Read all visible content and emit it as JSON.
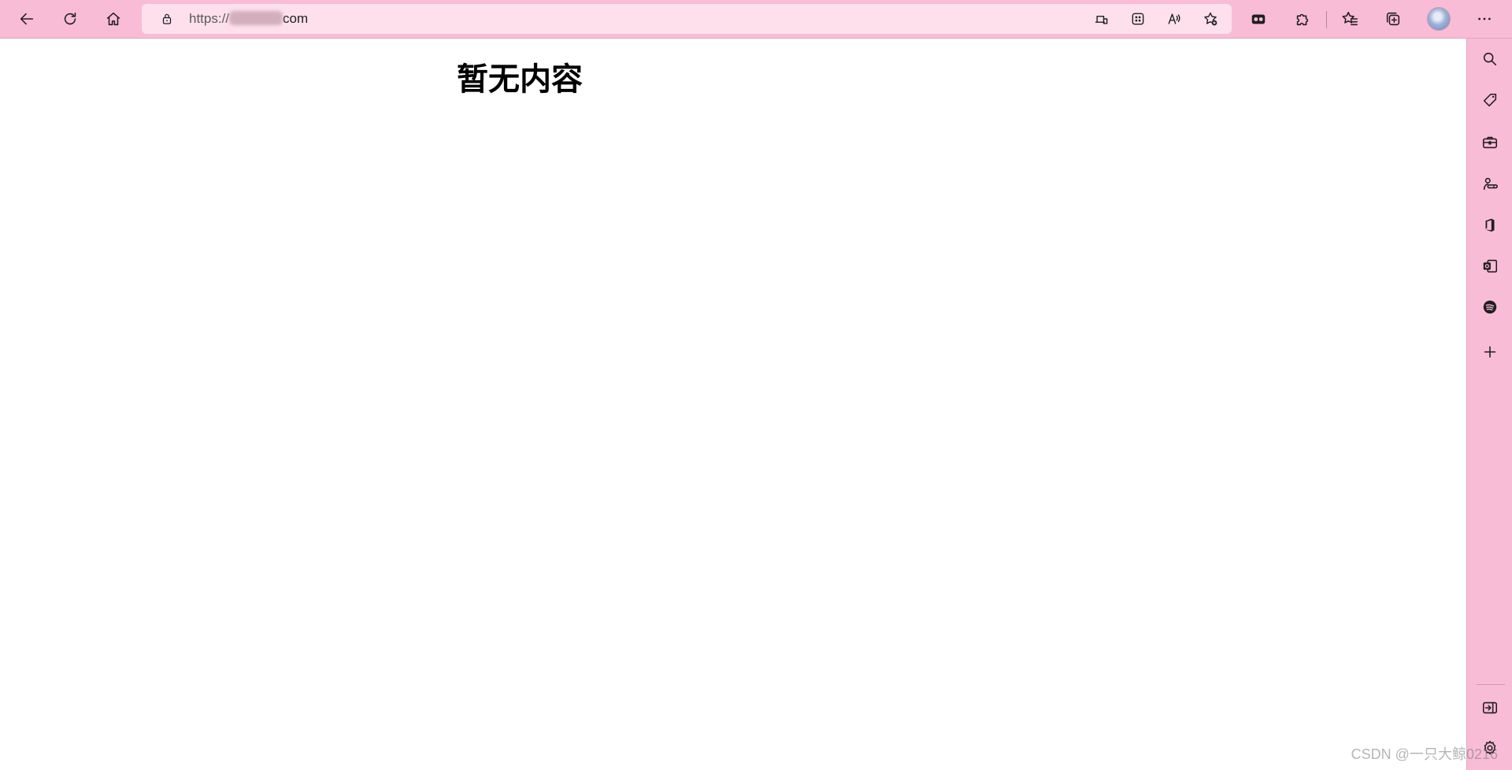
{
  "browser": {
    "address_bar": {
      "url_scheme": "https://",
      "url_suffix": "com"
    },
    "toolbar_icons": [
      "back-icon",
      "refresh-icon",
      "home-icon",
      "lock-icon",
      "app-available-icon",
      "qr-code-icon",
      "read-aloud-icon",
      "add-favorite-icon",
      "extension-icon",
      "puzzle-icon",
      "favorites-icon",
      "collections-icon",
      "avatar",
      "more-icon"
    ],
    "sidebar_icons": [
      "search-icon",
      "shopping-tag-icon",
      "tools-icon",
      "games-icon",
      "office-icon",
      "outlook-icon",
      "spotify-icon",
      "add-icon",
      "hide-sidebar-icon",
      "settings-icon"
    ],
    "theme_color": "#f9bcd6"
  },
  "page": {
    "title": "暂无内容"
  },
  "watermark": "CSDN @一只大鲸0216"
}
